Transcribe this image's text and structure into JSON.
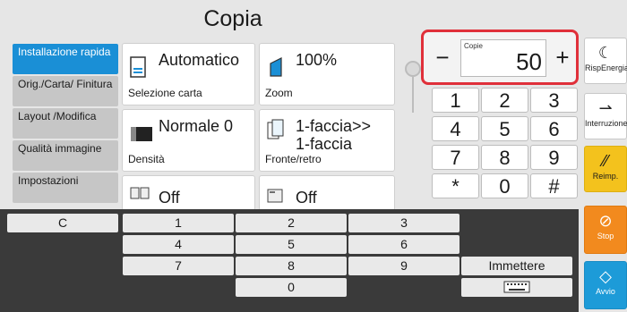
{
  "title": "Copia",
  "nav": [
    {
      "label": "Installazione rapida",
      "active": true
    },
    {
      "label": "Orig./Carta/ Finitura"
    },
    {
      "label": "Layout /Modifica"
    },
    {
      "label": "Qualità immagine"
    },
    {
      "label": "Impostazioni"
    }
  ],
  "cards": {
    "paper": {
      "value": "Automatico",
      "label": "Selezione carta"
    },
    "zoom": {
      "value": "100%",
      "label": "Zoom"
    },
    "density": {
      "value": "Normale 0",
      "label": "Densità"
    },
    "duplex": {
      "value": "1-faccia>> 1-faccia",
      "label": "Fronte/retro"
    },
    "combine": {
      "value": "Off"
    },
    "staple": {
      "value": "Off"
    }
  },
  "copies": {
    "label": "Copie",
    "value": "50",
    "minus": "−",
    "plus": "+"
  },
  "keypad": [
    "1",
    "2",
    "3",
    "4",
    "5",
    "6",
    "7",
    "8",
    "9",
    "*",
    "0",
    "#"
  ],
  "right": {
    "energy": "RispEnergia",
    "interrupt": "Interruzione",
    "reset": "Reimp.",
    "stop": "Stop",
    "start": "Avvio"
  },
  "keyboard": {
    "clear": "C",
    "digits": [
      "1",
      "2",
      "3",
      "4",
      "5",
      "6",
      "7",
      "8",
      "9",
      "0"
    ],
    "enter": "Immettere"
  },
  "colors": {
    "accent": "#1a8fd6",
    "highlight": "#e0303a",
    "stop": "#f28a1e",
    "reset": "#f3c21d",
    "start": "#1d9bd8"
  }
}
